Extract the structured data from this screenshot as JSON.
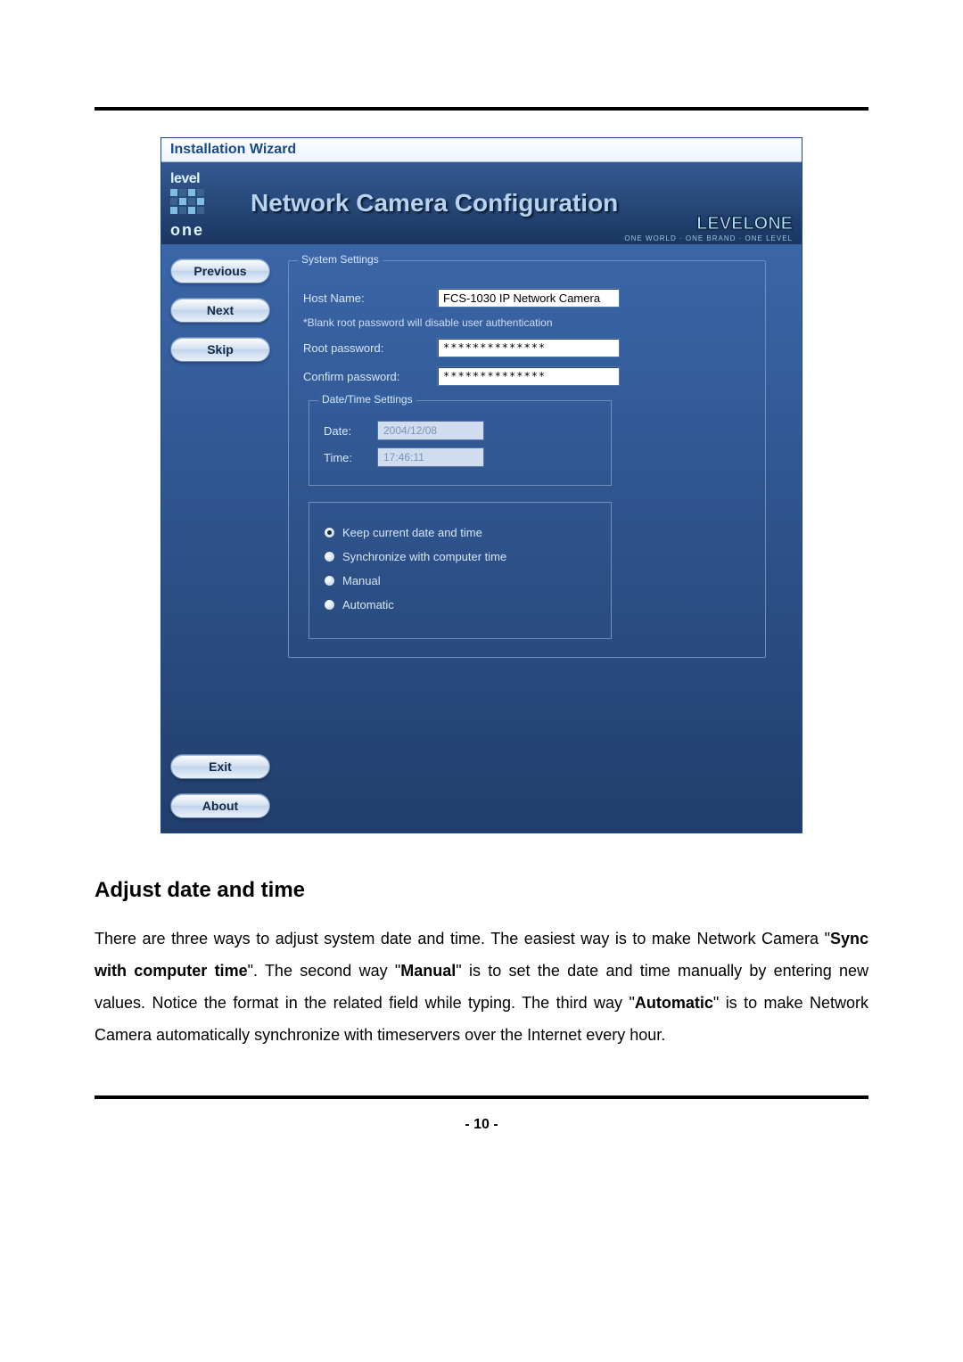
{
  "page": {
    "number": "- 10 -"
  },
  "screenshot": {
    "titlebar": "Installation Wizard",
    "logo": {
      "word1": "level",
      "word2": "one"
    },
    "header_title": "Network Camera Configuration",
    "brand": {
      "main": "LEVELONE",
      "sub": "ONE WORLD · ONE BRAND · ONE LEVEL"
    },
    "sidebar": {
      "previous": "Previous",
      "next": "Next",
      "skip": "Skip",
      "exit": "Exit",
      "about": "About"
    },
    "system_settings": {
      "legend": "System Settings",
      "host_name_label": "Host Name:",
      "host_name_value": "FCS-1030 IP Network Camera",
      "hint": "*Blank root password will disable user authentication",
      "root_pw_label": "Root password:",
      "root_pw_value": "**************",
      "confirm_pw_label": "Confirm password:",
      "confirm_pw_value": "**************",
      "datetime": {
        "legend": "Date/Time Settings",
        "date_label": "Date:",
        "date_value": "2004/12/08",
        "time_label": "Time:",
        "time_value": "17:46:11",
        "options": {
          "keep": "Keep current date and time",
          "sync": "Synchronize with computer time",
          "manual": "Manual",
          "auto": "Automatic",
          "selected": "keep"
        }
      }
    }
  },
  "section": {
    "heading": "Adjust date and time",
    "p1a": "There are three ways to adjust system date and time. The easiest way is to make Network Camera \"",
    "p1_bold1": "Sync with computer time",
    "p1b": "\". The second way \"",
    "p1_bold2": "Manual",
    "p1c": "\" is to set the date and time manually by entering new values. Notice the format in the related field while typing. The third way \"",
    "p1_bold3": "Automatic",
    "p1d": "\" is to make Network Camera automatically synchronize with timeservers over the Internet every hour."
  }
}
